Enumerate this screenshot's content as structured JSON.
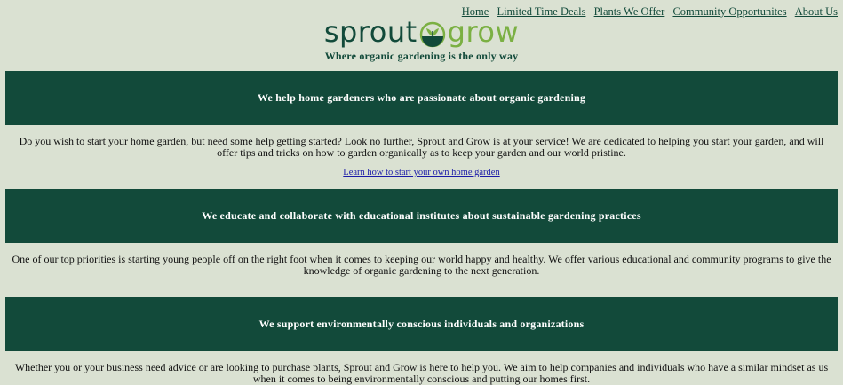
{
  "nav": {
    "items": [
      {
        "label": "Home"
      },
      {
        "label": "Limited Time Deals"
      },
      {
        "label": "Plants We Offer"
      },
      {
        "label": "Community Opportunites"
      },
      {
        "label": "About Us"
      }
    ]
  },
  "header": {
    "logo_word_1": "sprout",
    "logo_word_2": "grow",
    "tagline": "Where organic gardening is the only way"
  },
  "sections": [
    {
      "heading": "We help home gardeners who are passionate about organic gardening",
      "text": "Do you wish to start your home garden, but need some help getting started? Look no further, Sprout and Grow is at your service! We are dedicated to helping you start your garden, and will offer tips and tricks on how to garden organically as to keep your garden and our world pristine.",
      "link": "Learn how to start your own home garden"
    },
    {
      "heading": "We educate and collaborate with educational institutes about sustainable gardening practices",
      "text": "One of our top priorities is starting young people off on the right foot when it comes to keeping our world happy and healthy. We offer various educational and community programs to give the knowledge of organic gardening to the next generation."
    },
    {
      "heading": "We support environmentally conscious individuals and organizations",
      "text": "Whether you or your business need advice or are looking to purchase plants, Sprout and Grow is here to help you. We aim to help companies and individuals who have a similar mindset as us when it comes to being environmentally conscious and putting our homes first."
    }
  ],
  "colors": {
    "background": "#dae1d2",
    "banner": "#124a3a",
    "brand_green_light": "#7bb043",
    "link": "#1a1aa8"
  },
  "icons": {
    "logo_mark": "sprout-seed-icon"
  }
}
